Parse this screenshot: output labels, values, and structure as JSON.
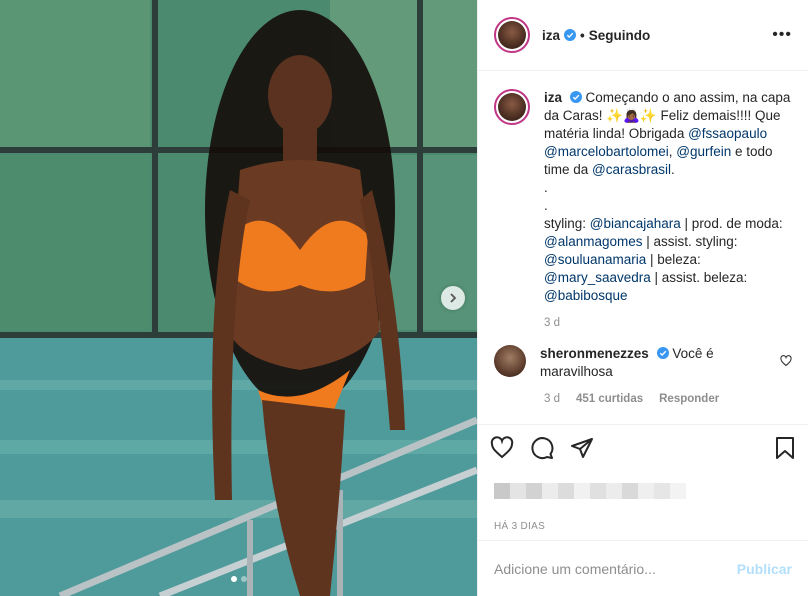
{
  "header": {
    "username": "iza",
    "separator": "•",
    "following_label": "Seguindo",
    "more_icon": "more-horizontal-icon"
  },
  "caption": {
    "username": "iza",
    "parts": [
      {
        "t": "Começando o ano assim, na capa da Caras! ✨🙇🏾‍♀️✨ Feliz demais!!!! Que matéria linda! Obrigada "
      },
      {
        "m": "@fssaopaulo"
      },
      {
        "t": " "
      },
      {
        "m": "@marcelobartolomei"
      },
      {
        "t": ", "
      },
      {
        "m": "@gurfein"
      },
      {
        "t": " e todo time da "
      },
      {
        "m": "@carasbrasil"
      },
      {
        "t": "."
      },
      {
        "br": true
      },
      {
        "t": "."
      },
      {
        "br": true
      },
      {
        "t": "."
      },
      {
        "br": true
      },
      {
        "t": "styling: "
      },
      {
        "m": "@biancajahara"
      },
      {
        "t": " | prod. de moda: "
      },
      {
        "m": "@alanmagomes"
      },
      {
        "t": " | assist. styling: "
      },
      {
        "m": "@souluanamaria"
      },
      {
        "t": " | beleza: "
      },
      {
        "m": "@mary_saavedra"
      },
      {
        "t": " | assist. beleza: "
      },
      {
        "m": "@babibosque"
      }
    ],
    "time": "3 d"
  },
  "comment": {
    "username": "sheronmenezzes",
    "text": "Você é maravilhosa",
    "time": "3 d",
    "likes": "451 curtidas",
    "reply": "Responder"
  },
  "actions": {
    "like_icon": "heart-icon",
    "comment_icon": "comment-icon",
    "share_icon": "share-icon",
    "save_icon": "bookmark-icon"
  },
  "date": "HÁ 3 DIAS",
  "add_comment": {
    "placeholder": "Adicione um comentário...",
    "publish": "Publicar"
  },
  "colors": {
    "mention": "#00376b",
    "verified": "#3897f0",
    "publish_disabled": "#b2dffc",
    "story_ring": "#c13584"
  }
}
